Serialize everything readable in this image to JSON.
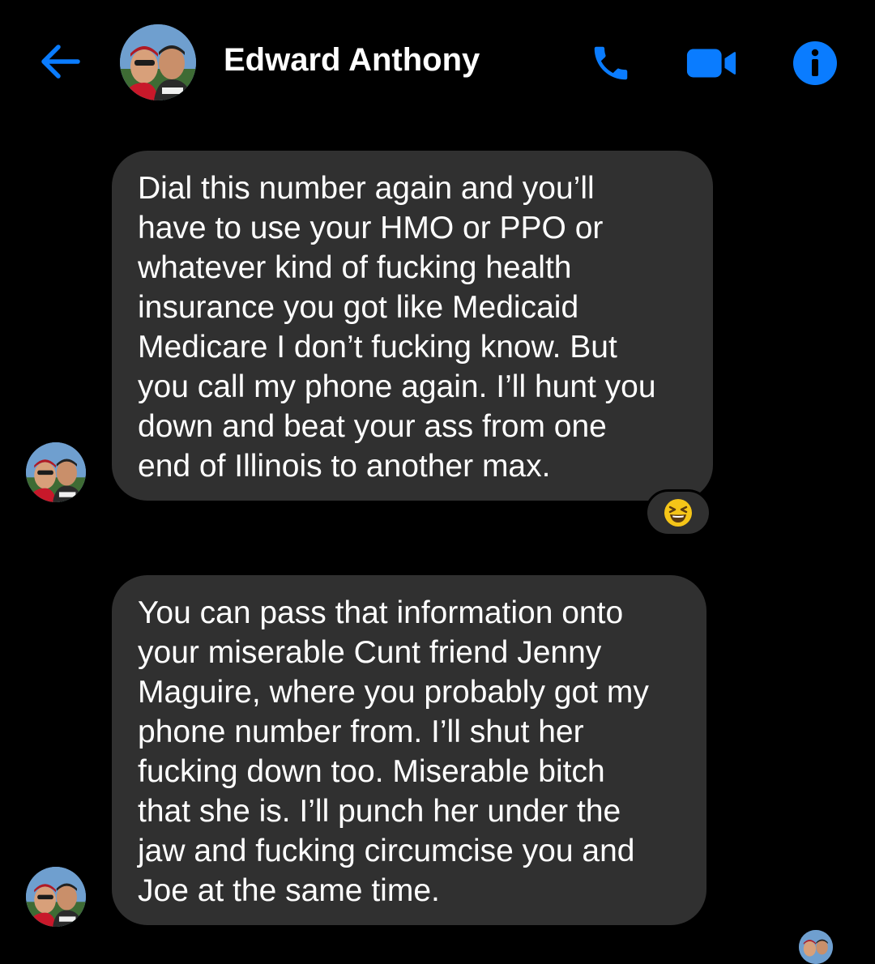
{
  "header": {
    "contact_name": "Edward Anthony",
    "back_icon": "arrow-left-icon",
    "call_icon": "phone-icon",
    "video_icon": "video-camera-icon",
    "info_icon": "info-icon"
  },
  "messages": [
    {
      "lines": [
        "Dial this number again and you’ll",
        "have to use your HMO or PPO or",
        "whatever kind of fucking health",
        "insurance you got like Medicaid",
        "Medicare I don’t fucking know. But",
        "you call my phone again. I’ll hunt you",
        "down and beat your ass from one",
        "end of Illinois to another max."
      ],
      "reaction": "😆"
    },
    {
      "lines": [
        "You can pass that information onto",
        "your miserable Cunt friend Jenny",
        "Maguire, where you probably got my",
        "phone number from. I’ll shut her",
        "fucking down too. Miserable bitch",
        "that she is. I’ll punch her under the",
        "jaw and fucking circumcise you and",
        "Joe at the same time."
      ]
    }
  ],
  "colors": {
    "background": "#000000",
    "bubble": "#303030",
    "accent": "#0a7cff",
    "text": "#ffffff",
    "reaction_emoji": "#f5c518"
  }
}
